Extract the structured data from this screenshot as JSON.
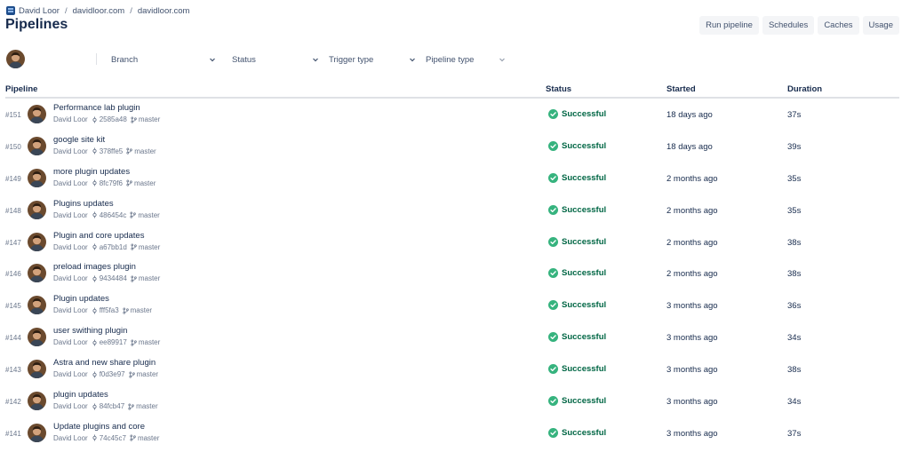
{
  "breadcrumb": {
    "workspace": "David Loor",
    "project": "davidloor.com",
    "repository": "davidloor.com"
  },
  "page_title": "Pipelines",
  "actions": {
    "run_pipeline": "Run pipeline",
    "schedules": "Schedules",
    "caches": "Caches",
    "usage": "Usage"
  },
  "filters": {
    "branch": "Branch",
    "status": "Status",
    "trigger_type": "Trigger type",
    "pipeline_type": "Pipeline type"
  },
  "table": {
    "columns": {
      "pipeline": "Pipeline",
      "status": "Status",
      "started": "Started",
      "duration": "Duration"
    },
    "rows": [
      {
        "number": "#151",
        "title": "Performance lab plugin",
        "author": "David Loor",
        "commit": "2585a48",
        "branch": "master",
        "status": "Successful",
        "started": "18 days ago",
        "duration": "37s"
      },
      {
        "number": "#150",
        "title": "google site kit",
        "author": "David Loor",
        "commit": "378ffe5",
        "branch": "master",
        "status": "Successful",
        "started": "18 days ago",
        "duration": "39s"
      },
      {
        "number": "#149",
        "title": "more plugin updates",
        "author": "David Loor",
        "commit": "8fc79f6",
        "branch": "master",
        "status": "Successful",
        "started": "2 months ago",
        "duration": "35s"
      },
      {
        "number": "#148",
        "title": "Plugins updates",
        "author": "David Loor",
        "commit": "486454c",
        "branch": "master",
        "status": "Successful",
        "started": "2 months ago",
        "duration": "35s"
      },
      {
        "number": "#147",
        "title": "Plugin and core updates",
        "author": "David Loor",
        "commit": "a67bb1d",
        "branch": "master",
        "status": "Successful",
        "started": "2 months ago",
        "duration": "38s"
      },
      {
        "number": "#146",
        "title": "preload images plugin",
        "author": "David Loor",
        "commit": "9434484",
        "branch": "master",
        "status": "Successful",
        "started": "2 months ago",
        "duration": "38s"
      },
      {
        "number": "#145",
        "title": "Plugin updates",
        "author": "David Loor",
        "commit": "fff5fa3",
        "branch": "master",
        "status": "Successful",
        "started": "3 months ago",
        "duration": "36s"
      },
      {
        "number": "#144",
        "title": "user swithing plugin",
        "author": "David Loor",
        "commit": "ee89917",
        "branch": "master",
        "status": "Successful",
        "started": "3 months ago",
        "duration": "34s"
      },
      {
        "number": "#143",
        "title": "Astra and new share plugin",
        "author": "David Loor",
        "commit": "f0d3e97",
        "branch": "master",
        "status": "Successful",
        "started": "3 months ago",
        "duration": "38s"
      },
      {
        "number": "#142",
        "title": "plugin updates",
        "author": "David Loor",
        "commit": "84fcb47",
        "branch": "master",
        "status": "Successful",
        "started": "3 months ago",
        "duration": "34s"
      },
      {
        "number": "#141",
        "title": "Update plugins and core",
        "author": "David Loor",
        "commit": "74c45c7",
        "branch": "master",
        "status": "Successful",
        "started": "3 months ago",
        "duration": "37s"
      }
    ]
  },
  "colors": {
    "success": "#006644",
    "success_icon": "#36b37e",
    "text": "#172b4d",
    "muted": "#6b778c",
    "button_bg": "#f4f5f7"
  },
  "icons": {
    "workspace": "workspace-logo-icon",
    "commit": "commit-icon",
    "branch": "branch-icon",
    "status": "check-circle-icon",
    "dropdown": "chevron-down-icon"
  }
}
